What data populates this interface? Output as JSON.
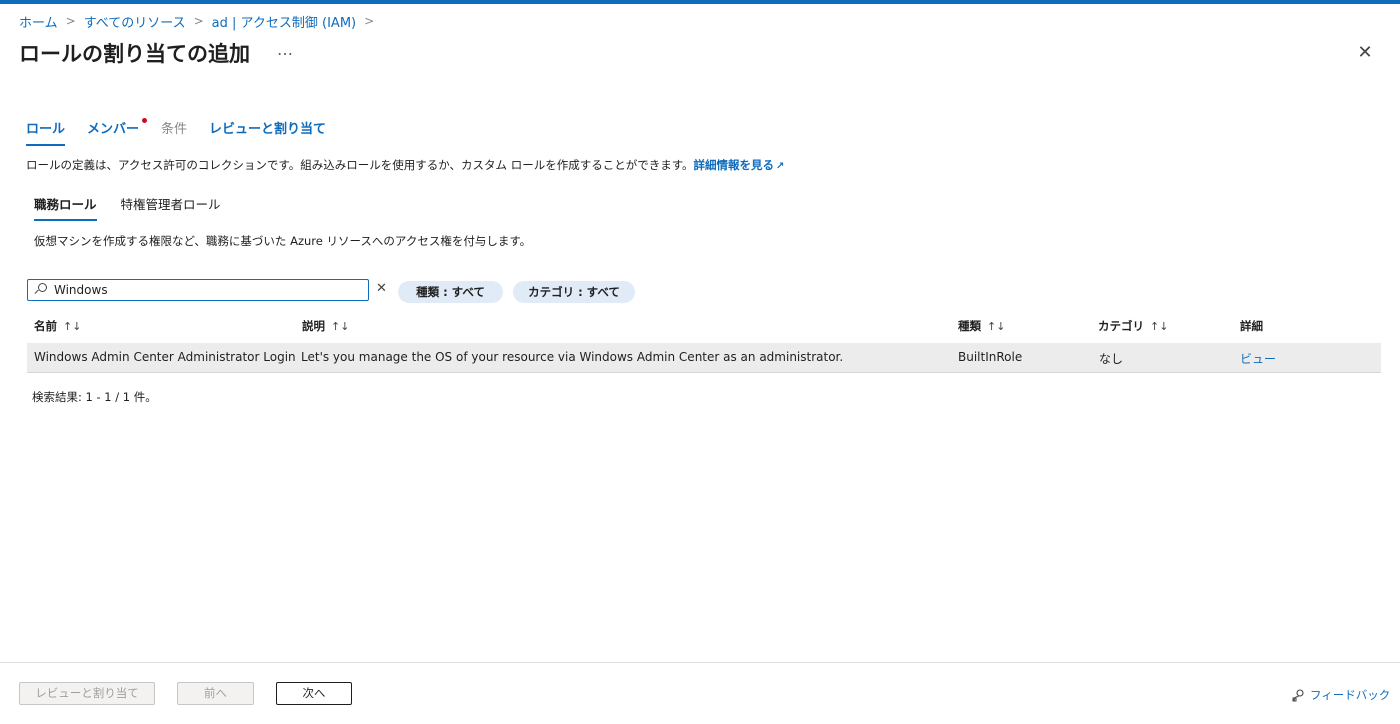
{
  "breadcrumb": {
    "items": [
      "ホーム",
      "すべてのリソース",
      "ad | アクセス制御 (IAM)"
    ]
  },
  "header": {
    "title": "ロールの割り当ての追加",
    "more": "…"
  },
  "wizard_tabs": [
    {
      "label": "ロール",
      "state": "active"
    },
    {
      "label": "メンバー",
      "state": "enabled"
    },
    {
      "label": "条件",
      "state": "disabled"
    },
    {
      "label": "レビューと割り当て",
      "state": "enabled"
    }
  ],
  "role_description": {
    "text": "ロールの定義は、アクセス許可のコレクションです。組み込みロールを使用するか、カスタム ロールを作成することができます。",
    "link": "詳細情報を見る"
  },
  "role_tabs": [
    {
      "label": "職務ロール",
      "active": true
    },
    {
      "label": "特権管理者ロール",
      "active": false
    }
  ],
  "job_role_description": "仮想マシンを作成する権限など、職務に基づいた Azure リソースへのアクセス権を付与します。",
  "search": {
    "value": "Windows",
    "placeholder": ""
  },
  "filters": {
    "type": "種類 : すべて",
    "category": "カテゴリ : すべて"
  },
  "table": {
    "columns": [
      "名前",
      "説明",
      "種類",
      "カテゴリ",
      "詳細"
    ],
    "sort_indicator": "↑↓",
    "rows": [
      {
        "name": "Windows Admin Center Administrator Login",
        "description": "Let's you manage the OS of your resource via Windows Admin Center as an administrator.",
        "type": "BuiltInRole",
        "category": "なし",
        "details": "ビュー"
      }
    ]
  },
  "result_count": "検索結果: 1 - 1 / 1 件。",
  "footer": {
    "review_assign": "レビューと割り当て",
    "previous": "前へ",
    "next": "次へ",
    "feedback": "フィードバック"
  },
  "colors": {
    "accent": "#0f6cbd",
    "required_dot": "#c50f1f",
    "pill_bg": "#e0ebf7",
    "row_selected": "#ececec"
  }
}
